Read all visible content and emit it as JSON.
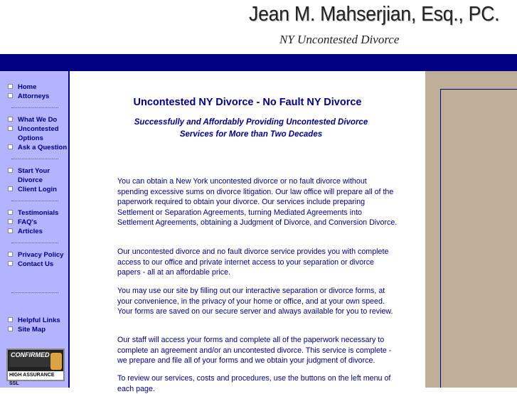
{
  "header": {
    "firm_name": "Jean M. Mahserjian, Esq., PC.",
    "tagline": "NY Uncontested Divorce"
  },
  "sidebar": {
    "items": [
      {
        "label": "Home"
      },
      {
        "label": "Attorneys"
      },
      {
        "label": "What We Do"
      },
      {
        "label": "Uncontested Options"
      },
      {
        "label": "Ask a Question"
      },
      {
        "label": "Start Your Divorce"
      },
      {
        "label": "Client Login"
      },
      {
        "label": "Testimonials"
      },
      {
        "label": "FAQ's"
      },
      {
        "label": "Articles"
      },
      {
        "label": "Privacy Policy"
      },
      {
        "label": "Contact Us"
      },
      {
        "label": "Helpful Links"
      },
      {
        "label": "Site Map"
      }
    ],
    "badge": {
      "top_text": "CONFIRMED",
      "bottom_text": "HIGH ASSURANCE SSL"
    }
  },
  "main": {
    "title": "Uncontested NY Divorce - No Fault NY Divorce",
    "subtitle": "Successfully and Affordably Providing Uncontested Divorce Services for More than Two Decades",
    "paragraphs": [
      "You can obtain a New York uncontested divorce or no fault divorce without spending excessive sums on divorce litigation.  Our law office will prepare all of the paperwork required to obtain your divorce.  Our services include preparing Settlement or Separation Agreements, turning Mediated Agreements into Settlement Agreements, obtaining a Judgment of Divorce, and Conversion Divorce.",
      "Our uncontested divorce and no fault divorce service provides you with complete access to our office and private internet access to your separation or divorce papers - all at an affordable price.",
      "You may use our site by filling out our interactive separation or divorce forms, at your convenience, in the privacy of your home or office, and at your own speed.  Your forms are saved on our secure server and always available for you to review.",
      "Our staff will access your forms and complete all of the paperwork necessary to complete an agreement and/or an uncontested divorce.  This service is complete - we prepare and file all of your forms and we obtain your judgment of divorce.",
      "To review our services, costs and procedures, use the buttons on the left menu of each page."
    ]
  },
  "colors": {
    "navy": "#000080",
    "sidebar_bg": "#b3b3ff",
    "right_panel_bg": "#bfae98"
  }
}
